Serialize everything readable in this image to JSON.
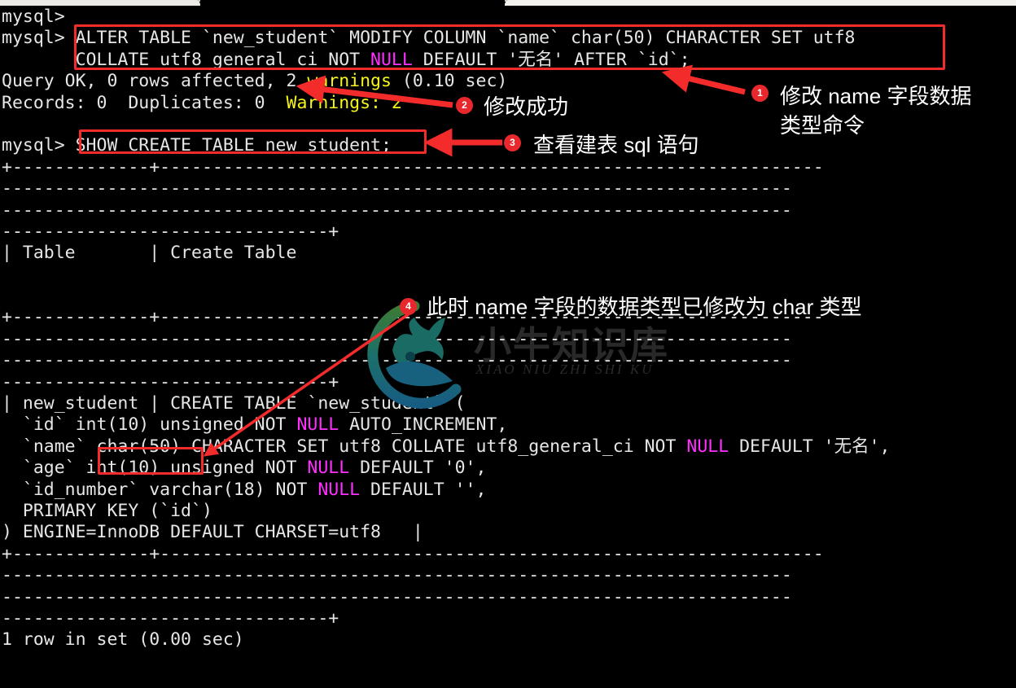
{
  "terminal": {
    "lines": [
      {
        "id": "prompt-1",
        "segments": [
          {
            "t": "mysql> "
          }
        ]
      },
      {
        "id": "cmd-alter-1",
        "segments": [
          {
            "t": "mysql> "
          },
          {
            "t": "ALTER TABLE `new_student` MODIFY COLUMN `name` char(50) CHARACTER SET utf8"
          }
        ]
      },
      {
        "id": "cmd-alter-2",
        "segments": [
          {
            "t": "       COLLATE utf8 general ci NOT "
          },
          {
            "t": "NULL",
            "c": "kw-null"
          },
          {
            "t": " DEFAULT '无名' AFTER `id`;"
          }
        ]
      },
      {
        "id": "query-ok",
        "segments": [
          {
            "t": "Query OK, 0 rows affected, 2 "
          },
          {
            "t": "warnings",
            "c": "kw-warn"
          },
          {
            "t": " (0.10 sec)"
          }
        ]
      },
      {
        "id": "records-line",
        "segments": [
          {
            "t": "Records: 0  Duplicates: 0  "
          },
          {
            "t": "Warnings: 2",
            "c": "kw-warn"
          }
        ]
      },
      {
        "id": "blank-1",
        "segments": [
          {
            "t": ""
          }
        ]
      },
      {
        "id": "cmd-show",
        "segments": [
          {
            "t": "mysql> "
          },
          {
            "t": "SHOW CREATE TABLE new student;"
          }
        ]
      },
      {
        "id": "sep-top-1",
        "segments": [
          {
            "t": "+-------------+---------------------------------------------------------------"
          }
        ]
      },
      {
        "id": "sep-top-2",
        "segments": [
          {
            "t": "---------------------------------------------------------------------------"
          }
        ]
      },
      {
        "id": "sep-top-3",
        "segments": [
          {
            "t": "---------------------------------------------------------------------------"
          }
        ]
      },
      {
        "id": "sep-top-4",
        "segments": [
          {
            "t": "-------------------------------+"
          }
        ]
      },
      {
        "id": "col-headers",
        "segments": [
          {
            "t": "| Table       | Create Table"
          }
        ]
      },
      {
        "id": "blank-2",
        "segments": [
          {
            "t": ""
          }
        ]
      },
      {
        "id": "blank-3",
        "segments": [
          {
            "t": ""
          }
        ]
      },
      {
        "id": "sep-mid-1",
        "segments": [
          {
            "t": "+-------------+---------------------------------------------------------------"
          }
        ]
      },
      {
        "id": "sep-mid-2",
        "segments": [
          {
            "t": "---------------------------------------------------------------------------"
          }
        ]
      },
      {
        "id": "sep-mid-3",
        "segments": [
          {
            "t": "---------------------------------------------------------------------------"
          }
        ]
      },
      {
        "id": "sep-mid-4",
        "segments": [
          {
            "t": "-------------------------------+"
          }
        ]
      },
      {
        "id": "row-create-1",
        "segments": [
          {
            "t": "| new_student | CREATE TABLE `new_student` ("
          }
        ]
      },
      {
        "id": "row-create-2",
        "segments": [
          {
            "t": "  `id` int(10) unsigned NOT "
          },
          {
            "t": "NULL",
            "c": "kw-null"
          },
          {
            "t": " AUTO_INCREMENT,"
          }
        ]
      },
      {
        "id": "row-create-3",
        "segments": [
          {
            "t": "  `name` char(50) CHARACTER SET utf8 COLLATE utf8_general_ci NOT "
          },
          {
            "t": "NULL",
            "c": "kw-null"
          },
          {
            "t": " DEFAULT '无名',"
          }
        ]
      },
      {
        "id": "row-create-4",
        "segments": [
          {
            "t": "  `age` int(10) unsigned NOT "
          },
          {
            "t": "NULL",
            "c": "kw-null"
          },
          {
            "t": " DEFAULT '0',"
          }
        ]
      },
      {
        "id": "row-create-5",
        "segments": [
          {
            "t": "  `id_number` varchar(18) NOT "
          },
          {
            "t": "NULL",
            "c": "kw-null"
          },
          {
            "t": " DEFAULT '',"
          }
        ]
      },
      {
        "id": "row-create-6",
        "segments": [
          {
            "t": "  PRIMARY KEY (`id`)"
          }
        ]
      },
      {
        "id": "row-create-7",
        "segments": [
          {
            "t": ") ENGINE=InnoDB DEFAULT CHARSET=utf8   |"
          }
        ]
      },
      {
        "id": "sep-bot-1",
        "segments": [
          {
            "t": "+-------------+---------------------------------------------------------------"
          }
        ]
      },
      {
        "id": "sep-bot-2",
        "segments": [
          {
            "t": "---------------------------------------------------------------------------"
          }
        ]
      },
      {
        "id": "sep-bot-3",
        "segments": [
          {
            "t": "---------------------------------------------------------------------------"
          }
        ]
      },
      {
        "id": "sep-bot-4",
        "segments": [
          {
            "t": "-------------------------------+"
          }
        ]
      },
      {
        "id": "result-count",
        "segments": [
          {
            "t": "1 row in set (0.00 sec)"
          }
        ]
      }
    ]
  },
  "annotations": {
    "items": [
      {
        "num": "1",
        "text": "修改 name 字段数据\n类型命令"
      },
      {
        "num": "2",
        "text": "修改成功"
      },
      {
        "num": "3",
        "text": "查看建表 sql 语句"
      },
      {
        "num": "4",
        "text": "此时 name 字段的数据类型已修改为 char 类型"
      }
    ],
    "colors": {
      "badge": "#e8282d",
      "box": "#f42b2b",
      "arrow": "#f42b2b",
      "text": "#ffffff"
    }
  },
  "watermark": {
    "cn": "小牛知识库",
    "pinyin": "XIAO NIU ZHI SHI KU"
  }
}
